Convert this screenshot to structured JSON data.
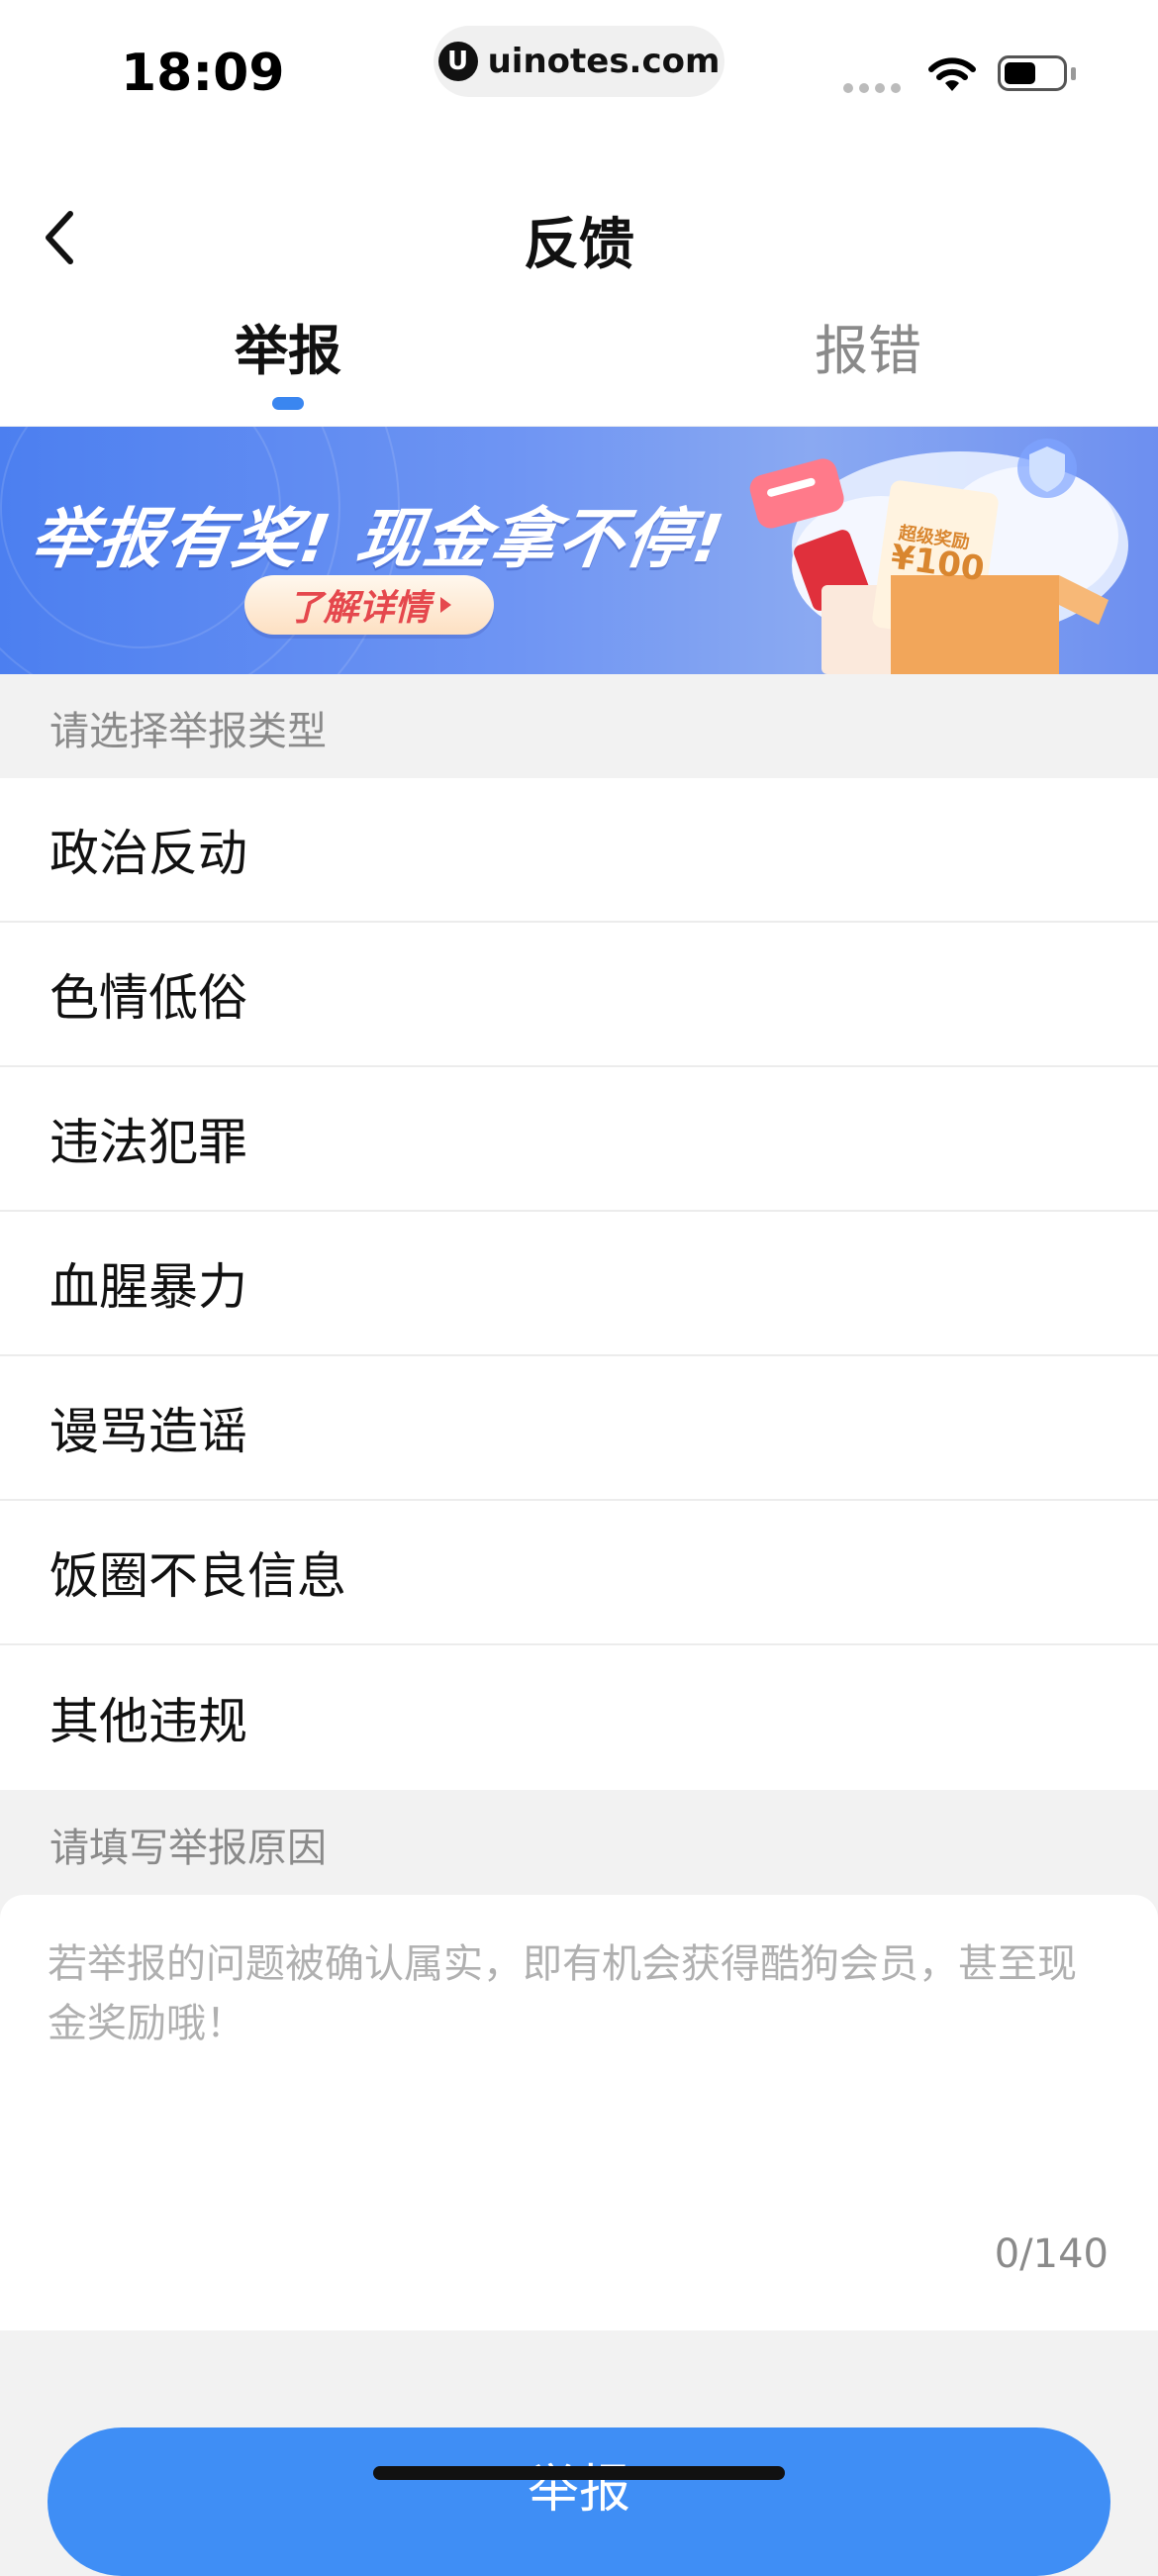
{
  "status_bar": {
    "time": "18:09",
    "url_logo": "U",
    "url": "uinotes.com",
    "battery_level": 0.55
  },
  "nav": {
    "title": "反馈",
    "back_icon": "chevron-left-icon"
  },
  "tabs": [
    {
      "label": "举报",
      "active": true
    },
    {
      "label": "报错",
      "active": false
    }
  ],
  "banner": {
    "headline": "举报有奖! 现金拿不停!",
    "button_label": "了解详情",
    "coupon_label": "超级奖励",
    "coupon_amount": "¥100"
  },
  "report_types": {
    "label": "请选择举报类型",
    "items": [
      "政治反动",
      "色情低俗",
      "违法犯罪",
      "血腥暴力",
      "谩骂造谣",
      "饭圈不良信息",
      "其他违规"
    ]
  },
  "reason": {
    "label": "请填写举报原因",
    "value": "",
    "placeholder": "若举报的问题被确认属实，即有机会获得酷狗会员，甚至现金奖励哦！",
    "char_count": "0/140"
  },
  "submit": {
    "label": "举报"
  },
  "colors": {
    "accent": "#3f8ef5",
    "tab_indicator": "#3a86f0",
    "banner_start": "#4c7ff0",
    "banner_button_text": "#e5484d",
    "page_background": "#f2f2f2"
  }
}
